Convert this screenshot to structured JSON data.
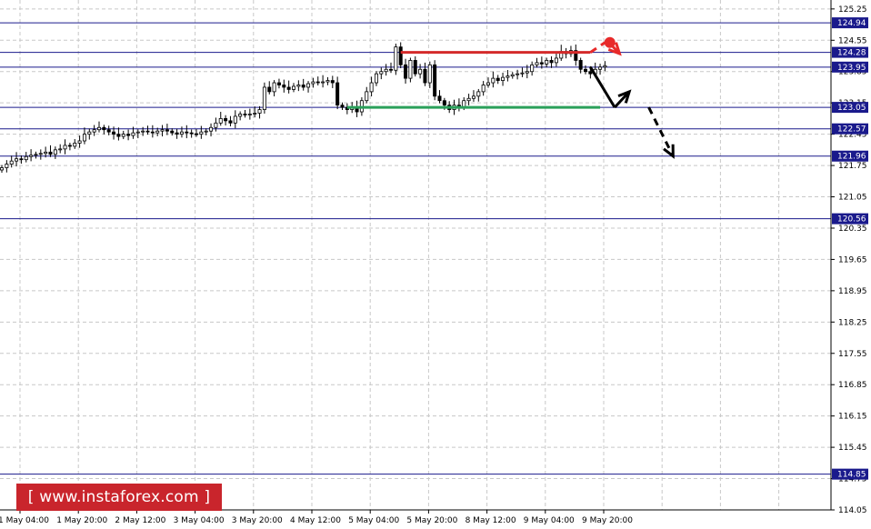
{
  "chart_data": {
    "type": "candlestick",
    "instrument_note": "",
    "y_range": [
      114.05,
      125.45
    ],
    "y_ticks": [
      125.25,
      124.55,
      123.85,
      123.15,
      122.45,
      121.75,
      121.05,
      120.35,
      119.65,
      118.95,
      118.25,
      117.55,
      116.85,
      116.15,
      115.45,
      114.75,
      114.05
    ],
    "x_ticks": [
      "1 May 04:00",
      "1 May 20:00",
      "2 May 12:00",
      "3 May 04:00",
      "3 May 20:00",
      "4 May 12:00",
      "5 May 04:00",
      "5 May 20:00",
      "8 May 12:00",
      "9 May 04:00",
      "9 May 20:00"
    ],
    "levels": [
      {
        "value": 124.94,
        "label": "124.94"
      },
      {
        "value": 124.28,
        "label": "124.28"
      },
      {
        "value": 123.95,
        "label": "123.95"
      },
      {
        "value": 123.05,
        "label": "123.05"
      },
      {
        "value": 122.57,
        "label": "122.57"
      },
      {
        "value": 121.96,
        "label": "121.96"
      },
      {
        "value": 120.56,
        "label": "120.56"
      },
      {
        "value": 114.85,
        "label": "114.85"
      }
    ],
    "resistance": {
      "value": 124.28,
      "from_bar": 82,
      "to_bar": 121,
      "color": "#d42a2a"
    },
    "support": {
      "value": 123.05,
      "from_bar": 71,
      "to_bar": 123,
      "color": "#2aa05a"
    },
    "closes": [
      121.7,
      121.78,
      121.85,
      121.9,
      121.88,
      121.95,
      121.98,
      122.0,
      122.02,
      122.05,
      122.0,
      122.1,
      122.12,
      122.2,
      122.18,
      122.25,
      122.3,
      122.45,
      122.5,
      122.55,
      122.6,
      122.55,
      122.5,
      122.45,
      122.4,
      122.45,
      122.42,
      122.48,
      122.5,
      122.52,
      122.5,
      122.48,
      122.52,
      122.55,
      122.52,
      122.48,
      122.45,
      122.5,
      122.48,
      122.46,
      122.45,
      122.5,
      122.52,
      122.6,
      122.7,
      122.8,
      122.75,
      122.7,
      122.85,
      122.9,
      122.88,
      122.9,
      122.92,
      123.0,
      123.5,
      123.4,
      123.6,
      123.55,
      123.5,
      123.45,
      123.52,
      123.55,
      123.5,
      123.58,
      123.62,
      123.6,
      123.62,
      123.65,
      123.6,
      123.1,
      123.05,
      123.0,
      123.05,
      122.95,
      123.2,
      123.4,
      123.6,
      123.8,
      123.85,
      123.9,
      123.88,
      124.4,
      124.0,
      123.7,
      124.1,
      123.8,
      123.9,
      123.6,
      124.0,
      123.3,
      123.2,
      123.1,
      123.0,
      123.1,
      123.05,
      123.2,
      123.25,
      123.3,
      123.4,
      123.55,
      123.6,
      123.7,
      123.65,
      123.72,
      123.75,
      123.78,
      123.8,
      123.82,
      123.85,
      124.0,
      124.05,
      124.02,
      124.1,
      124.05,
      124.15,
      124.3,
      124.25,
      124.32,
      124.1,
      123.9,
      123.85,
      123.8,
      123.9,
      123.95,
      123.98
    ],
    "arrows": [
      {
        "style": "solid",
        "color": "#000000",
        "from": [
          121,
          123.95
        ],
        "to": [
          126,
          123.05
        ],
        "head": false
      },
      {
        "style": "solid",
        "color": "#000000",
        "from": [
          126,
          123.05
        ],
        "to": [
          129,
          123.4
        ],
        "head": true
      },
      {
        "style": "dashed",
        "color": "#000000",
        "from": [
          133,
          123.05
        ],
        "to": [
          138,
          121.96
        ],
        "head": true
      },
      {
        "style": "dashed",
        "color": "#e82a2a",
        "from": [
          121,
          124.28
        ],
        "to": [
          124,
          124.5
        ],
        "head": false
      },
      {
        "style": "solid",
        "color": "#e82a2a",
        "from": [
          125,
          124.48
        ],
        "to": [
          127,
          124.25
        ],
        "head": true
      }
    ],
    "grid": true
  },
  "watermark": {
    "text": "[ www.instaforex.com ]"
  }
}
